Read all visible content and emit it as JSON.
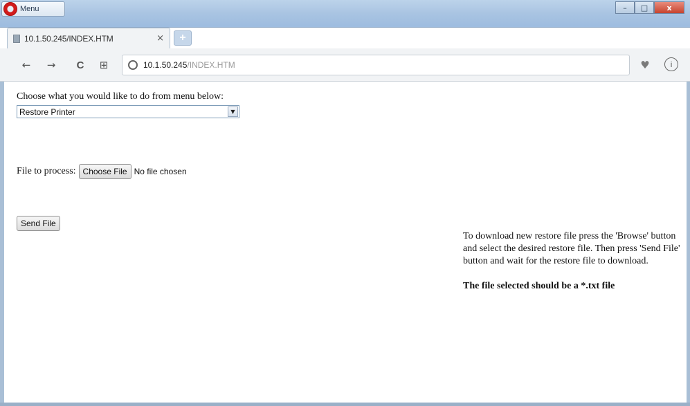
{
  "browser": {
    "menu_label": "Menu",
    "tab_title": "10.1.50.245/INDEX.HTM",
    "tab_close": "×",
    "new_tab": "+",
    "url_host": "10.1.50.245",
    "url_path": "/INDEX.HTM",
    "window_controls": {
      "minimize": "–",
      "maximize": "□",
      "close": "x"
    },
    "icons": {
      "back": "←",
      "forward": "→",
      "reload": "C",
      "tabs": "⊞",
      "bookmark": "♥",
      "download": "i"
    },
    "colors": {
      "accent_logo": "#d21b1b",
      "titlebar": "#a9c4e2"
    }
  },
  "page": {
    "prompt": "Choose what you would like to do from menu below:",
    "select_value": "Restore Printer",
    "file_label": "File to process:",
    "choose_file_button": "Choose File",
    "no_file_text": "No file chosen",
    "send_button": "Send File",
    "help_text": "To download new restore file press the 'Browse' button and select the desired restore file. Then press 'Send File' button and wait for the restore file to download.",
    "help_warning": "The file selected should be a *.txt file"
  }
}
